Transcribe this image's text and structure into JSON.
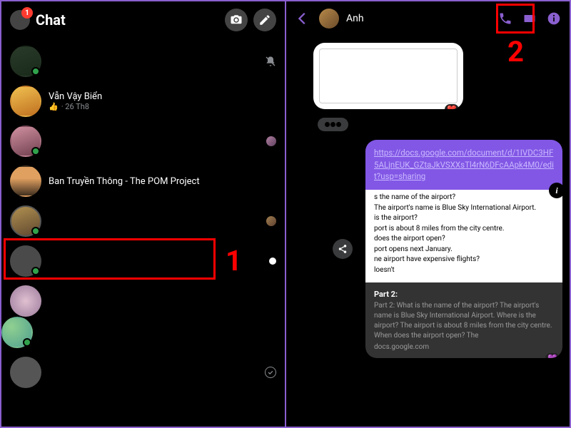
{
  "header": {
    "title": "Chat",
    "badge": "1"
  },
  "chatList": [
    {
      "name": "",
      "sub": "",
      "status": "mute",
      "online": true
    },
    {
      "name": "Vẫn Vậy Biển",
      "sub_prefix": "👍",
      "sub_text": " · 26 Th8",
      "status": "none",
      "online": false
    },
    {
      "name": "",
      "sub": "",
      "status": "seen",
      "online": true
    },
    {
      "name": "Ban Truyền Thông - The POM Project",
      "sub": "",
      "status": "none",
      "online": false
    },
    {
      "name": "",
      "sub": "",
      "status": "seen",
      "online": true
    },
    {
      "name": "",
      "sub": "",
      "status": "unread",
      "online": true
    },
    {
      "name": "",
      "sub": "",
      "status": "none",
      "online": false
    },
    {
      "name": "",
      "sub": "",
      "status": "none",
      "online": true
    },
    {
      "name": "",
      "sub": "",
      "status": "check",
      "online": false
    }
  ],
  "conversation": {
    "name": "Anh",
    "link_url": "https://docs.google.com/document/d/1IVDC3HF5ALjnEUK_GZtaJkVSXXsTl4rN6DFcAApk4M0/edit?usp=sharing",
    "preview_lines": [
      "s the name of the airport?",
      "The airport's name is Blue Sky International Airport.",
      "is the airport?",
      "port is about 8 miles from the city centre.",
      "does the airport open?",
      "port opens next January.",
      "ne airport have expensive flights?",
      "loesn't"
    ],
    "card_title": "Part 2:",
    "card_desc": "Part 2: What is the name of the airport? The airport's name is Blue Sky International Airport. Where is the airport? The airport is about 8 miles from the city centre. When does the airport open? The",
    "card_domain": "docs.google.com",
    "heart": "❤️",
    "purple_heart": "💜"
  },
  "annotations": {
    "one": "1",
    "two": "2"
  }
}
